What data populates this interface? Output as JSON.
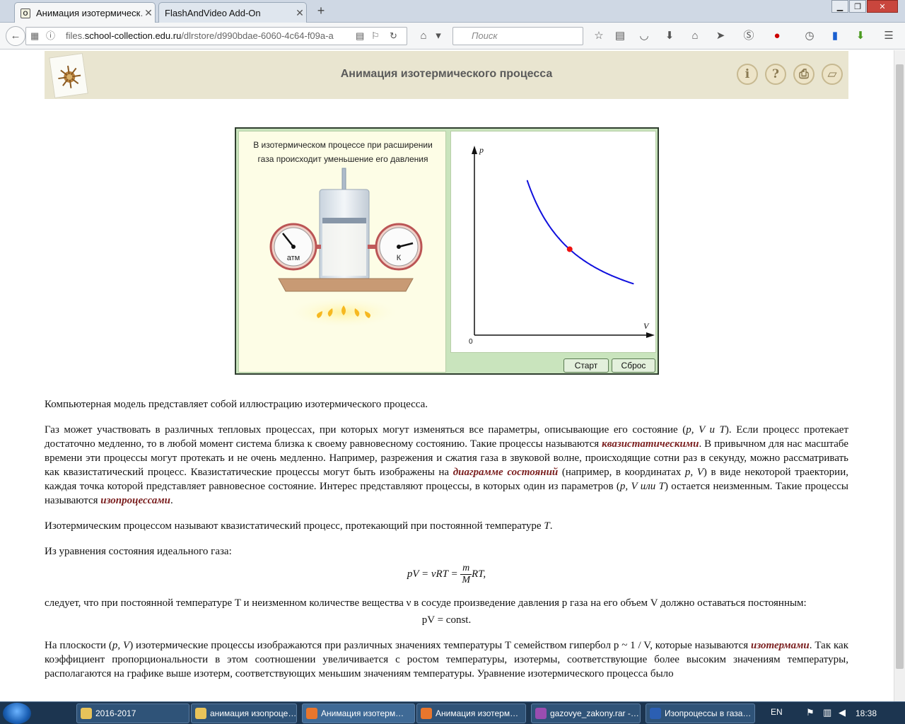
{
  "browser": {
    "tabs": [
      {
        "label": "Анимация изотермическ…",
        "active": true
      },
      {
        "label": "FlashAndVideo Add-On",
        "active": false
      }
    ],
    "url_prefix": "files.",
    "url_domain": "school-collection.edu.ru",
    "url_path": "/dlrstore/d990bdae-6060-4c64-f09a-a",
    "search_placeholder": "Поиск"
  },
  "page": {
    "title": "Анимация изотермического процесса"
  },
  "animation": {
    "caption": "В изотермическом процессе при расширении газа происходит уменьшение его давления",
    "gauge_left_label": "атм",
    "gauge_right_label": "К",
    "start_label": "Старт",
    "reset_label": "Сброс"
  },
  "chart_data": {
    "type": "line",
    "title": "",
    "xlabel": "V",
    "ylabel": "p",
    "origin_label": "0",
    "curve_color": "#1010dd",
    "marker_color": "#ee1111",
    "x": [
      1.0,
      1.2,
      1.4,
      1.6,
      1.8,
      2.0,
      2.2,
      2.4,
      2.6,
      2.8,
      3.0
    ],
    "y": [
      3.0,
      2.5,
      2.14,
      1.88,
      1.67,
      1.5,
      1.36,
      1.25,
      1.15,
      1.07,
      1.0
    ],
    "marker": {
      "x": 1.8,
      "y": 1.67
    },
    "xlim": [
      0,
      3.3
    ],
    "ylim": [
      0,
      3.6
    ],
    "grid": false
  },
  "article": {
    "p1": "Компьютерная модель представляет собой иллюстрацию изотермического процесса.",
    "p2a": "Газ может участвовать в различных тепловых процессах, при которых могут изменяться все параметры, описывающие его состояние (",
    "p2b": "). Если процесс протекает достаточно медленно, то в любой момент система близка к своему равновесному состоянию. Такие процессы называются ",
    "term_quasistatic": "квазистатическими",
    "p2c": ". В привычном для нас масштабе времени эти процессы могут протекать и не очень медленно. Например, разрежения и сжатия газа в звуковой волне, происходящие сотни раз в секунду, можно рассматривать как квазистатический процесс. Квазистатические процессы могут быть изображены на ",
    "term_diagram": "диаграмме состояний",
    "p2d": " (например, в координатах ",
    "p2e": ") в виде некоторой траектории, каждая точка которой представляет равновесное состояние. Интерес представляют процессы, в которых один из параметров (",
    "p2f": ") остается неизменным. Такие процессы называются ",
    "term_isoprocess": "изопроцессами",
    "p2g": ".",
    "vars_pvt": "p, V и T",
    "vars_pv": "p, V",
    "vars_pvt_or": "p, V или T",
    "p3a": "Изотермическим процессом называют квазистатический процесс, протекающий при постоянной температуре ",
    "p3b": "T",
    "p3c": ".",
    "p4": "Из уравнения состояния идеального газа:",
    "f1_left": "pV = νRT = ",
    "f1_num": "m",
    "f1_den": "M",
    "f1_right": "RT,",
    "p5": "следует, что при постоянной температуре T и неизменном количестве вещества ν в сосуде произведение давления p газа на его объем V должно оставаться постоянным:",
    "f2": "pV = const.",
    "p6a": "На плоскости (",
    "p6b": "p, V",
    "p6c": ") изотермические процессы изображаются при различных значениях температуры T семейством гипербол p ~ 1 / V, которые называются ",
    "term_isotherms": "изотермами",
    "p6d": ". Так как коэффициент пропорциональности в этом соотношении увеличивается с ростом температуры, изотермы, соответствующие более высоким значениям температуры, располагаются на графике выше изотерм, соответствующих меньшим значениям температуры. Уравнение изотермического процесса было"
  },
  "taskbar": {
    "items": [
      {
        "label": "2016-2017",
        "color": "#e8c35a"
      },
      {
        "label": "анимация изопроце…",
        "color": "#e8c35a"
      },
      {
        "label": "Анимация изотерм…",
        "color": "#e8762d"
      },
      {
        "label": "Анимация изотерм…",
        "color": "#e8762d"
      },
      {
        "label": "gazovye_zakony.rar -…",
        "color": "#9a4db0"
      },
      {
        "label": "Изопроцессы в газа…",
        "color": "#2b5fb3"
      }
    ],
    "lang": "EN",
    "time": "18:38"
  }
}
